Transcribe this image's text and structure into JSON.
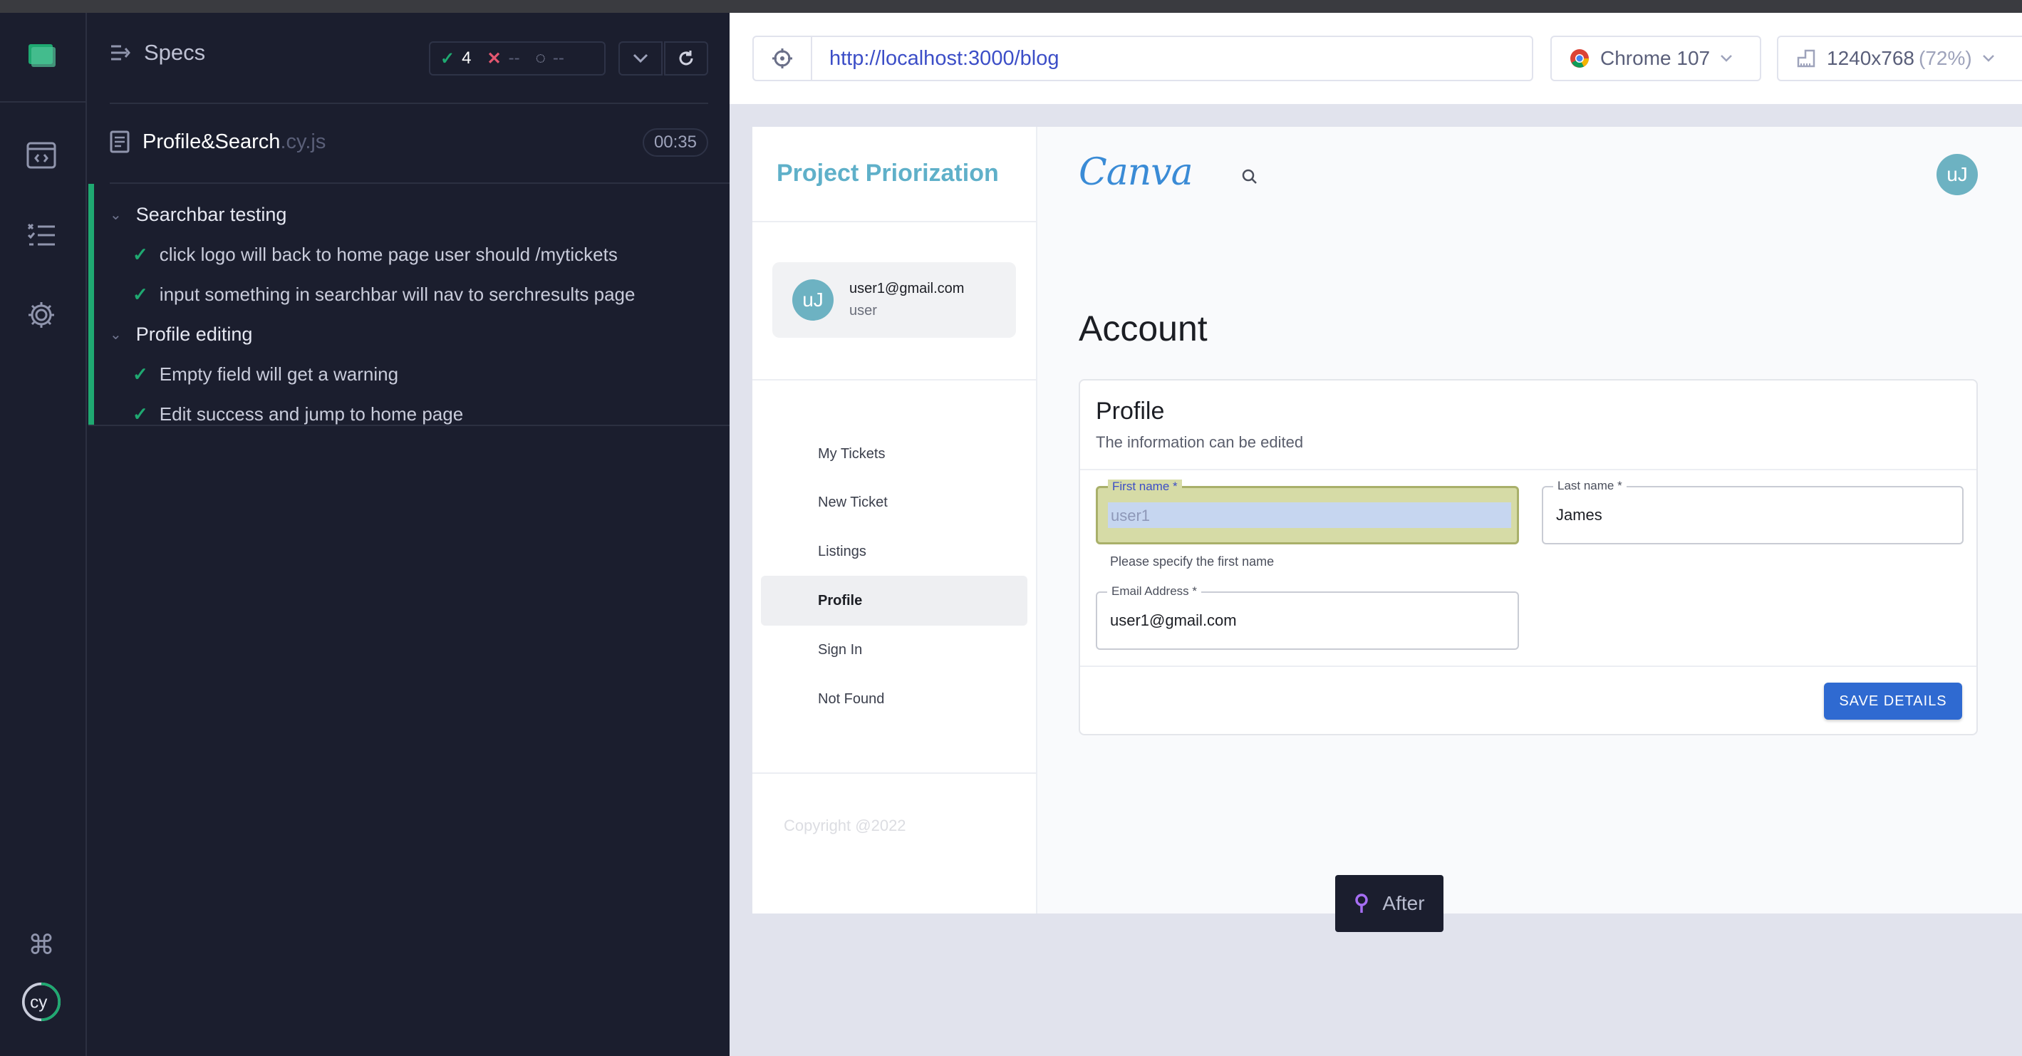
{
  "runner": {
    "specs_title": "Specs",
    "stats": {
      "passed": "4",
      "failed": "--",
      "pending": "--"
    },
    "file": {
      "name": "Profile&Search",
      "ext": ".cy.js",
      "duration": "00:35"
    },
    "suites": [
      {
        "title": "Searchbar testing",
        "tests": [
          "click logo will back to home page user should /mytickets",
          "input something in searchbar will nav to serchresults page"
        ]
      },
      {
        "title": "Profile editing",
        "tests": [
          "Empty field will get a warning",
          "Edit success and jump to home page"
        ]
      }
    ],
    "snapshot_label": "After"
  },
  "browser": {
    "url": "http://localhost:3000/blog",
    "browser_name": "Chrome 107",
    "viewport": "1240x768",
    "viewport_scale": "(72%)"
  },
  "app": {
    "brand": "Project Priorization",
    "logo": "Canva",
    "avatar_initials": "uJ",
    "user": {
      "email": "user1@gmail.com",
      "role": "user"
    },
    "nav": [
      "My Tickets",
      "New Ticket",
      "Listings",
      "Profile",
      "Sign In",
      "Not Found"
    ],
    "active_nav": "Profile",
    "copyright": "Copyright @2022",
    "page_heading": "Account",
    "profile": {
      "title": "Profile",
      "subtitle": "The information can be edited",
      "first_name_label": "First name *",
      "first_name_value": "user1",
      "first_name_helper": "Please specify the first name",
      "last_name_label": "Last name *",
      "last_name_value": "James",
      "email_label": "Email Address *",
      "email_value": "user1@gmail.com",
      "save_label": "SAVE DETAILS"
    }
  },
  "colors": {
    "pass": "#1fa971",
    "fail": "#e45770",
    "accent": "#3c4ec7",
    "brand": "#5fb0c9",
    "button": "#2f6ad1"
  }
}
